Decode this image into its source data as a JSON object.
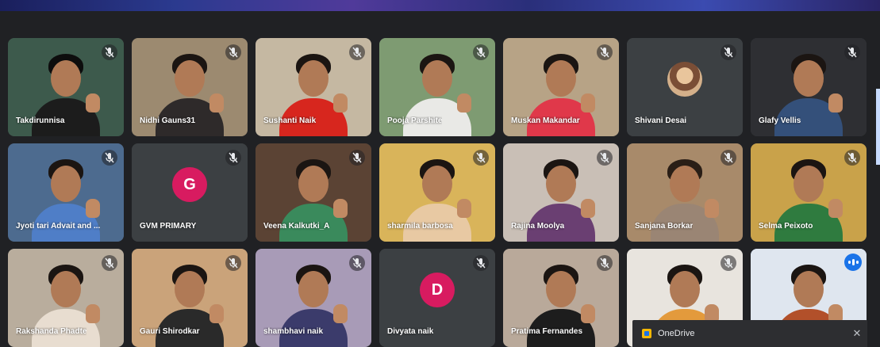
{
  "participants": [
    {
      "name": "Takdirunnisa",
      "muted": true,
      "bg": "#3d5a4c",
      "shirt": "#1c1c1c",
      "hair": "#0d0d0d"
    },
    {
      "name": "Nidhi Gauns31",
      "muted": true,
      "bg": "#9c8a70",
      "shirt": "#2e2a2a",
      "hair": "#1b1512"
    },
    {
      "name": "Sushanti Naik",
      "muted": true,
      "bg": "#c5b8a2",
      "shirt": "#d7261e",
      "hair": "#1b1512"
    },
    {
      "name": "Pooja Parshite",
      "muted": true,
      "bg": "#7e9b72",
      "shirt": "#e9e9e6",
      "hair": "#1b1512"
    },
    {
      "name": "Muskan Makandar",
      "muted": true,
      "bg": "#b7a386",
      "shirt": "#e0384a",
      "hair": "#1b1512"
    },
    {
      "name": "Shivani Desai",
      "muted": true,
      "bg": "#3c4043",
      "avatar_photo": true
    },
    {
      "name": "Glafy Vellis",
      "muted": true,
      "bg": "#2e2f33",
      "shirt": "#34507a",
      "hair": "#1b1512"
    },
    {
      "name": "Jyoti tari Advait and ...",
      "muted": true,
      "bg": "#4d6b8f",
      "shirt": "#4f7ec7",
      "hair": "#1b1512"
    },
    {
      "name": "GVM PRIMARY",
      "muted": true,
      "bg": "#3c4043",
      "initial": "G",
      "avatar_color": "#d81b60"
    },
    {
      "name": "Veena Kalkutki_A",
      "muted": true,
      "bg": "#5b4334",
      "shirt": "#3a8a5c",
      "hair": "#1b1512"
    },
    {
      "name": "sharmila barbosa",
      "muted": true,
      "bg": "#d9b45a",
      "shirt": "#e8c9a3",
      "hair": "#1b1512"
    },
    {
      "name": "Rajina Moolya",
      "muted": true,
      "bg": "#c9bfb6",
      "shirt": "#6a3f72",
      "hair": "#1b1512"
    },
    {
      "name": "Sanjana Borkar",
      "muted": true,
      "bg": "#a88a6a",
      "shirt": "#9a8574",
      "hair": "#2a1e16"
    },
    {
      "name": "Selma Peixoto",
      "muted": true,
      "bg": "#c9a24a",
      "shirt": "#2f7b3f",
      "hair": "#1b1512"
    },
    {
      "name": "Rakshanda Phadte",
      "muted": true,
      "bg": "#b9ad9d",
      "shirt": "#e8ddd0",
      "hair": "#1b1512"
    },
    {
      "name": "Gauri Shirodkar",
      "muted": true,
      "bg": "#caa37a",
      "shirt": "#2a2a2a",
      "hair": "#1b1512"
    },
    {
      "name": "shambhavi naik",
      "muted": true,
      "bg": "#a89bb7",
      "shirt": "#3b3b6b",
      "hair": "#1b1512"
    },
    {
      "name": "Divyata naik",
      "muted": true,
      "bg": "#3c4043",
      "initial": "D",
      "avatar_color": "#d81b60"
    },
    {
      "name": "Pratima Fernandes",
      "muted": true,
      "bg": "#b9a99a",
      "shirt": "#1d1d1d",
      "hair": "#1b1512"
    },
    {
      "name": "",
      "muted": true,
      "bg": "#e8e4de",
      "shirt": "#e39a3c",
      "hair": "#1b1512"
    },
    {
      "name": "",
      "muted": false,
      "speaking": true,
      "active": true,
      "bg": "#dfe6ef",
      "shirt": "#b2502a",
      "hair": "#1b1512"
    }
  ],
  "toast": {
    "app_name": "OneDrive",
    "close_glyph": "✕"
  },
  "colors": {
    "background": "#202124",
    "tile": "#3c4043",
    "active_border": "#8ab4f8",
    "speaking_badge": "#1a73e8"
  },
  "icons": {
    "mute": "mic-off-icon",
    "speaking": "audio-wave-icon",
    "onedrive": "onedrive-icon",
    "close": "close-icon"
  }
}
